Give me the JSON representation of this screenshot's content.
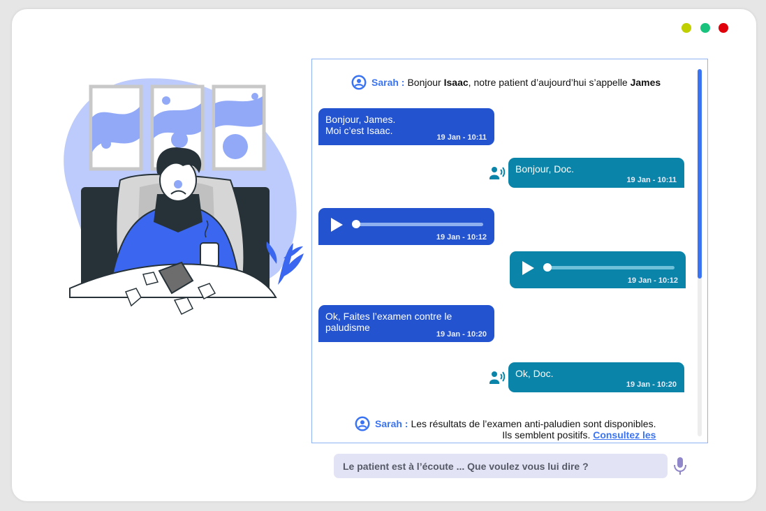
{
  "window": {
    "controls": [
      {
        "name": "minimize",
        "color": "#bfcf00"
      },
      {
        "name": "maximize",
        "color": "#19c37d"
      },
      {
        "name": "close",
        "color": "#e0000b"
      }
    ]
  },
  "chat": {
    "system1": {
      "sender": "Sarah :",
      "text_a": "Bonjour ",
      "bold1": "Isaac",
      "text_b": ", notre patient d’aujourd’hui s’appelle ",
      "bold2": "James"
    },
    "msg1": {
      "line1": "Bonjour, James.",
      "line2": "Moi c’est Isaac.",
      "time": "19 Jan - 10:11"
    },
    "msg2": {
      "text": "Bonjour, Doc.",
      "time": "19 Jan - 10:11"
    },
    "audio1": {
      "time": "19 Jan - 10:12",
      "progress": 0
    },
    "audio2": {
      "time": "19 Jan - 10:12",
      "progress": 0
    },
    "msg3": {
      "line1": "Ok, Faites l’examen contre le",
      "line2": "paludisme",
      "time": "19 Jan - 10:20"
    },
    "msg4": {
      "text": "Ok, Doc.",
      "time": "19 Jan - 10:20"
    },
    "system2": {
      "sender": "Sarah :",
      "line1": "Les résultats de l’examen anti-paludien sont disponibles.",
      "line2": "Ils semblent positifs. ",
      "link": "Consultez les"
    }
  },
  "input": {
    "placeholder": "Le patient est à l’écoute ... Que voulez vous lui dire ?"
  },
  "colors": {
    "accent": "#3b74f2",
    "doctor_bubble": "#2453d0",
    "patient_bubble": "#0a84a8",
    "input_bg": "#e3e3f6"
  }
}
